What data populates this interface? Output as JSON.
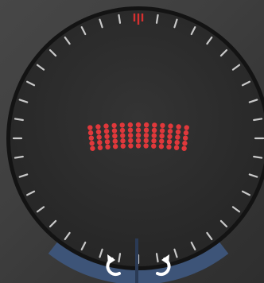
{
  "game": {
    "type": "rotary-dial-puzzle",
    "dial": {
      "tick_count": 40,
      "tick_color": "#c9c9c9",
      "marker_color": "#d63030",
      "face_color": "#2d2d2d",
      "rim_color": "#131313"
    },
    "dot_grid": {
      "rows": 5,
      "columns": 13,
      "dot_color": "#e0383b"
    },
    "controls": {
      "panel_color": "#3d5478",
      "rotate_left_icon": "rotate-counterclockwise-icon",
      "rotate_right_icon": "rotate-clockwise-icon",
      "icon_color": "#ffffff"
    }
  }
}
